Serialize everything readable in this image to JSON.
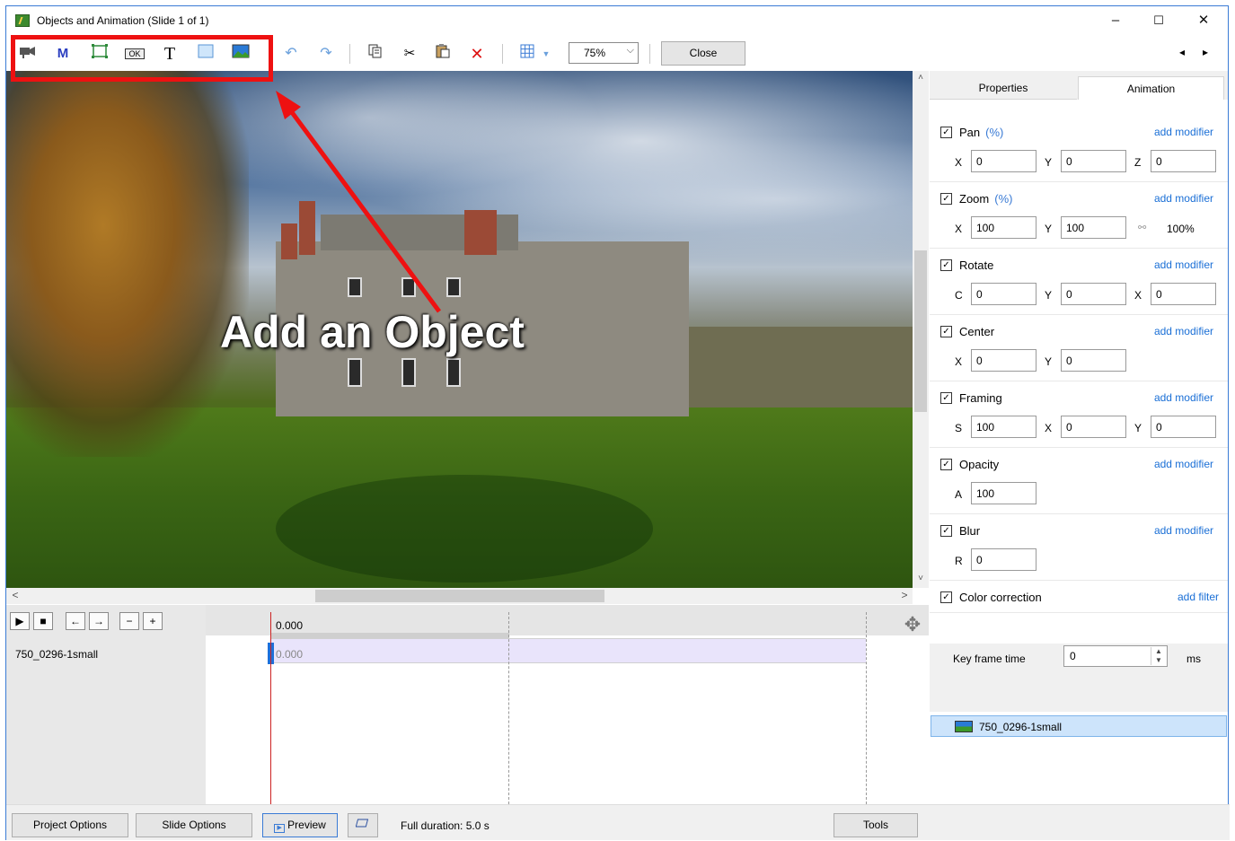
{
  "window": {
    "title": "Objects and Animation (Slide 1 of 1)",
    "minimize": "–",
    "maximize": "☐",
    "close": "✕"
  },
  "toolbar": {
    "zoom_value": "75%",
    "close_label": "Close",
    "nav_left": "◂",
    "nav_right": "▸",
    "icons": {
      "camera": "camera-icon",
      "mask": "M",
      "frame": "rectangle-icon",
      "button": "OK",
      "text": "T",
      "rectangle": "filled-rectangle-icon",
      "image": "image-icon",
      "undo": "↶",
      "redo": "↷",
      "copy": "copy-icon",
      "cut": "✂",
      "paste": "paste-icon",
      "delete": "✕",
      "grid": "grid-icon"
    }
  },
  "canvas": {
    "overlay_text": "Add an Object",
    "scroll_left": "<",
    "scroll_right": ">",
    "scroll_up": "˄",
    "scroll_down": "˅"
  },
  "timeline": {
    "header_time": "0.000",
    "row_label": "750_0296-1small",
    "row_time": "0.000",
    "controls": [
      "▶",
      "■",
      "←",
      "→",
      "−",
      "+"
    ]
  },
  "panel": {
    "tab_properties": "Properties",
    "tab_animation": "Animation",
    "sections": {
      "pan": {
        "label": "Pan",
        "unit": "(%)",
        "add": "add modifier",
        "f1_label": "X",
        "f1": "0",
        "f2_label": "Y",
        "f2": "0",
        "f3_label": "Z",
        "f3": "0"
      },
      "zoom": {
        "label": "Zoom",
        "unit": "(%)",
        "add": "add modifier",
        "f1_label": "X",
        "f1": "100",
        "f2_label": "Y",
        "f2": "100",
        "pct": "100%"
      },
      "rotate": {
        "label": "Rotate",
        "add": "add modifier",
        "f1_label": "C",
        "f1": "0",
        "f2_label": "Y",
        "f2": "0",
        "f3_label": "X",
        "f3": "0"
      },
      "center": {
        "label": "Center",
        "add": "add modifier",
        "f1_label": "X",
        "f1": "0",
        "f2_label": "Y",
        "f2": "0"
      },
      "framing": {
        "label": "Framing",
        "add": "add modifier",
        "f1_label": "S",
        "f1": "100",
        "f2_label": "X",
        "f2": "0",
        "f3_label": "Y",
        "f3": "0"
      },
      "opacity": {
        "label": "Opacity",
        "add": "add modifier",
        "f1_label": "A",
        "f1": "100"
      },
      "blur": {
        "label": "Blur",
        "add": "add modifier",
        "f1_label": "R",
        "f1": "0"
      },
      "color": {
        "label": "Color correction",
        "add": "add filter"
      }
    },
    "keyframe_label": "Key frame time",
    "keyframe_value": "0",
    "keyframe_unit": "ms",
    "object_item": "750_0296-1small"
  },
  "bottom": {
    "project_options": "Project Options",
    "slide_options": "Slide Options",
    "preview": "Preview",
    "full_duration": "Full duration: 5.0 s",
    "tools": "Tools"
  },
  "colors": {
    "highlight": "#ee1111",
    "link": "#1a6fd6",
    "keyframe": "#1e6fd9"
  }
}
